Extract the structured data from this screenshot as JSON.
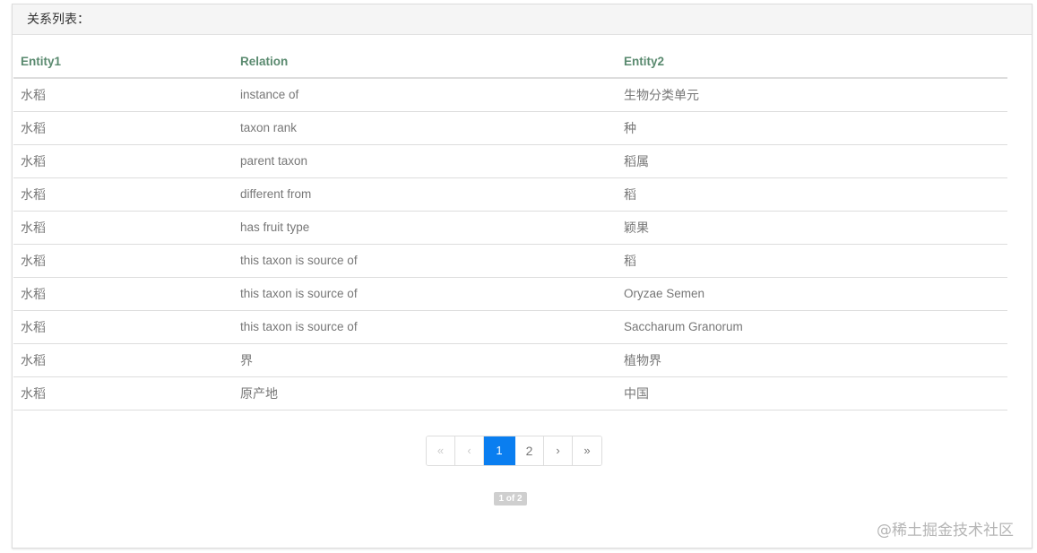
{
  "panel": {
    "title": "关系列表："
  },
  "table": {
    "headers": [
      "Entity1",
      "Relation",
      "Entity2"
    ],
    "rows": [
      [
        "水稻",
        "instance of",
        "生物分类单元"
      ],
      [
        "水稻",
        "taxon rank",
        "种"
      ],
      [
        "水稻",
        "parent taxon",
        "稻属"
      ],
      [
        "水稻",
        "different from",
        "稻"
      ],
      [
        "水稻",
        "has fruit type",
        "颖果"
      ],
      [
        "水稻",
        "this taxon is source of",
        "稻"
      ],
      [
        "水稻",
        "this taxon is source of",
        "Oryzae Semen"
      ],
      [
        "水稻",
        "this taxon is source of",
        "Saccharum Granorum"
      ],
      [
        "水稻",
        "界",
        "植物界"
      ],
      [
        "水稻",
        "原产地",
        "中国"
      ]
    ]
  },
  "pagination": {
    "first": "«",
    "prev": "‹",
    "pages": [
      "1",
      "2"
    ],
    "current_page": "1",
    "next": "›",
    "last": "»",
    "info": "1 of 2"
  },
  "watermark": {
    "text": "@稀土掘金技术社区"
  },
  "colors": {
    "header_text": "#5a8a6f",
    "active_page": "#0a7ef0",
    "body_text": "#777777"
  }
}
